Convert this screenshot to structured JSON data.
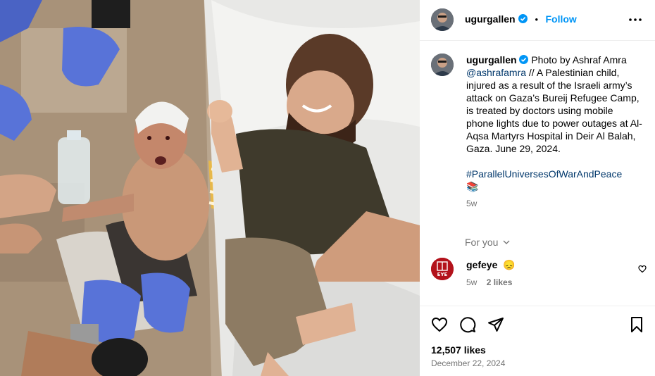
{
  "post": {
    "username": "ugurgallen",
    "dot": "•",
    "follow_label": "Follow",
    "caption_username": "ugurgallen",
    "caption_pre": " Photo by Ashraf Amra ",
    "caption_mention": "@ashrafamra",
    "caption_body": " // A Palestinian child, injured as a result of the Israeli army’s attack on Gaza’s Bureij Refugee Camp, is treated by doctors using mobile phone lights due to power outages at Al-Aqsa Martyrs Hospital in Deir Al Balah, Gaza. June 29, 2024.",
    "hashtag": "#ParallelUniversesOfWarAndPeace",
    "caption_emoji": "📚",
    "caption_age": "5w",
    "for_you_label": "For you",
    "likes": "12,507 likes",
    "date": "December 22, 2024"
  },
  "comment": {
    "username": "gefeye",
    "emoji": "😞",
    "age": "5w",
    "likes": "2 likes",
    "avatar_text": "EYE"
  },
  "colors": {
    "link": "#00376b",
    "follow": "#0095f6",
    "verified": "#0095f6",
    "muted": "#737373"
  },
  "icons": [
    "verified-icon",
    "more-icon",
    "chevron-down-icon",
    "heart-icon",
    "comment-icon",
    "share-icon",
    "bookmark-icon"
  ]
}
